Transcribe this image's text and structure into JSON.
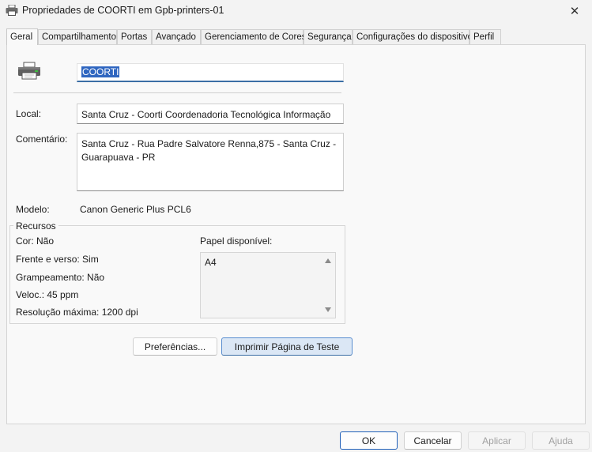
{
  "window": {
    "title": "Propriedades de COORTI em Gpb-printers-01",
    "close_glyph": "✕"
  },
  "tabs": [
    {
      "label": "Geral",
      "active": true
    },
    {
      "label": "Compartilhamento",
      "active": false
    },
    {
      "label": "Portas",
      "active": false
    },
    {
      "label": "Avançado",
      "active": false
    },
    {
      "label": "Gerenciamento de Cores",
      "active": false
    },
    {
      "label": "Segurança",
      "active": false
    },
    {
      "label": "Configurações do dispositivo",
      "active": false
    },
    {
      "label": "Perfil",
      "active": false
    }
  ],
  "general": {
    "printer_name": "COORTI",
    "location_label": "Local:",
    "location_value": "Santa Cruz - Coorti  Coordenadoria Tecnológica Informação",
    "comment_label": "Comentário:",
    "comment_value": "Santa Cruz - Rua Padre Salvatore Renna,875 - Santa Cruz - Guarapuava - PR",
    "model_label": "Modelo:",
    "model_value": "Canon Generic Plus PCL6"
  },
  "features": {
    "legend": "Recursos",
    "color": "Cor: Não",
    "duplex": "Frente e verso: Sim",
    "staple": "Grampeamento: Não",
    "speed": "Veloc.: 45 ppm",
    "resolution": "Resolução máxima: 1200 dpi",
    "paper_label": "Papel disponível:",
    "paper_items": [
      "A4"
    ]
  },
  "buttons": {
    "preferences": "Preferências...",
    "print_test": "Imprimir Página de Teste",
    "ok": "OK",
    "cancel": "Cancelar",
    "apply": "Aplicar",
    "help": "Ajuda"
  },
  "colors": {
    "accent": "#2f66c0",
    "default_button_border": "#1f5fb8"
  }
}
